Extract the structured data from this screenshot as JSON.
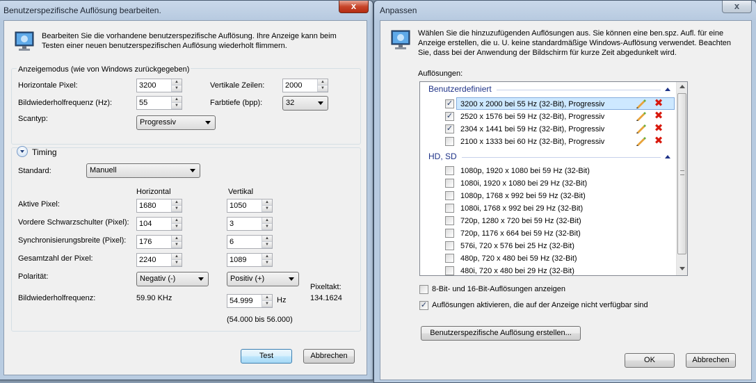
{
  "left_dialog": {
    "title": "Benutzerspezifische Auflösung bearbeiten.",
    "close_label": "x",
    "intro_text_1": "Bearbeiten Sie die vorhandene benutzerspezifische Auflösung. Ihre Anzeige kann beim",
    "intro_text_2": "Testen einer neuen benutzerspezifischen Auflösung wiederholt flimmern.",
    "display_mode_group": "Anzeigemodus (wie von Windows zurückgegeben)",
    "horizontal_pixels_label": "Horizontale Pixel:",
    "horizontal_pixels_value": "3200",
    "vertical_lines_label": "Vertikale Zeilen:",
    "vertical_lines_value": "2000",
    "refresh_rate_label": "Bildwiederholfrequenz (Hz):",
    "refresh_rate_value": "55",
    "color_depth_label": "Farbtiefe (bpp):",
    "color_depth_value": "32",
    "scan_type_label": "Scantyp:",
    "scan_type_value": "Progressiv",
    "timing_label": "Timing",
    "standard_label": "Standard:",
    "standard_value": "Manuell",
    "horizontal_header": "Horizontal",
    "vertical_header": "Vertikal",
    "timing_rows": [
      {
        "label": "Aktive Pixel:",
        "h": "1680",
        "v": "1050"
      },
      {
        "label": "Vordere Schwarzschulter (Pixel):",
        "h": "104",
        "v": "3"
      },
      {
        "label": "Synchronisierungsbreite (Pixel):",
        "h": "176",
        "v": "6"
      },
      {
        "label": "Gesamtzahl der Pixel:",
        "h": "2240",
        "v": "1089"
      }
    ],
    "polarity_label": "Polarität:",
    "polarity_h": "Negativ (-)",
    "polarity_v": "Positiv (+)",
    "pixel_clock_label": "Pixeltakt:",
    "pixel_clock_value": "134.1624",
    "refresh_label": "Bildwiederholfrequenz:",
    "refresh_h_value": "59.90 KHz",
    "refresh_v_value": "54.999",
    "refresh_v_unit": "Hz",
    "refresh_range": "(54.000 bis 56.000)",
    "test_button": "Test",
    "cancel_button": "Abbrechen"
  },
  "right_dialog": {
    "title": "Anpassen",
    "close_label": "x",
    "intro_text_1": "Wählen Sie die hinzuzufügenden Auflösungen aus. Sie können eine ben.spz. Aufl. für eine",
    "intro_text_2": "Anzeige erstellen, die u. U. keine standardmäßige Windows-Auflösung verwendet. Beachten",
    "intro_text_3": "Sie, dass bei der Anwendung der Bildschirm für kurze Zeit abgedunkelt wird.",
    "resolutions_label": "Auflösungen:",
    "custom_group": "Benutzerdefiniert",
    "custom_items": [
      {
        "label": "3200 x 2000 bei 55 Hz (32-Bit), Progressiv",
        "checked": true
      },
      {
        "label": "2520 x 1576 bei 59 Hz (32-Bit), Progressiv",
        "checked": true
      },
      {
        "label": "2304 x 1441 bei 59 Hz (32-Bit), Progressiv",
        "checked": true
      },
      {
        "label": "2100 x 1333 bei 60 Hz (32-Bit), Progressiv",
        "checked": false
      }
    ],
    "hd_group": "HD, SD",
    "hd_items": [
      "1080p, 1920 x 1080 bei 59 Hz (32-Bit)",
      "1080i, 1920 x 1080 bei 29 Hz (32-Bit)",
      "1080p, 1768 x 992 bei 59 Hz (32-Bit)",
      "1080i, 1768 x 992 bei 29 Hz (32-Bit)",
      "720p, 1280 x 720 bei 59 Hz (32-Bit)",
      "720p, 1176 x 664 bei 59 Hz (32-Bit)",
      "576i, 720 x 576 bei 25 Hz (32-Bit)",
      "480p, 720 x 480 bei 59 Hz (32-Bit)",
      "480i, 720 x 480 bei 29 Hz (32-Bit)"
    ],
    "show_8_16_bit": "8-Bit- und 16-Bit-Auflösungen anzeigen",
    "show_8_16_checked": false,
    "enable_unavailable": "Auflösungen aktivieren, die auf der Anzeige nicht verfügbar sind",
    "enable_unavailable_checked": true,
    "create_custom_button": "Benutzerspezifische Auflösung erstellen...",
    "ok_button": "OK",
    "cancel_button": "Abbrechen"
  },
  "colors": {
    "group_header": "#1e3287",
    "selected_row": "#cde8ff",
    "delete_red": "#d8190d"
  }
}
